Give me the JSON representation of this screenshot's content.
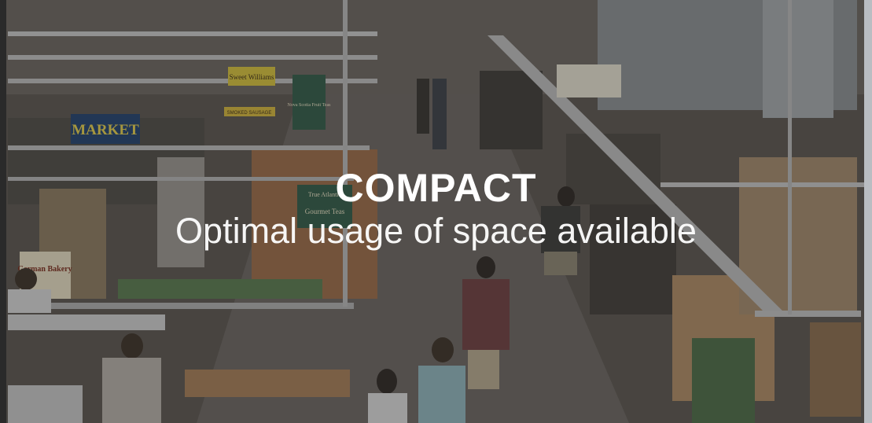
{
  "hero": {
    "headline": "COMPACT",
    "subline": "Optimal usage of space available",
    "background_image": "indoor-market-hall-photo",
    "signs": {
      "market": "MARKET",
      "sweet_williams": "Sweet Williams",
      "smoked_sausage": "SMOKED SAUSAGE",
      "nova_scotia": "Nova Scotia Fruit Teas",
      "true_atlantic": "True Atlantic",
      "gourmet_teas": "Gourmet Teas",
      "german_bakery": "German Bakery"
    }
  },
  "colors": {
    "overlay": "#282828",
    "text": "#ffffff",
    "market_sign": "#1f3f6e",
    "green_sign": "#2e5a45"
  }
}
